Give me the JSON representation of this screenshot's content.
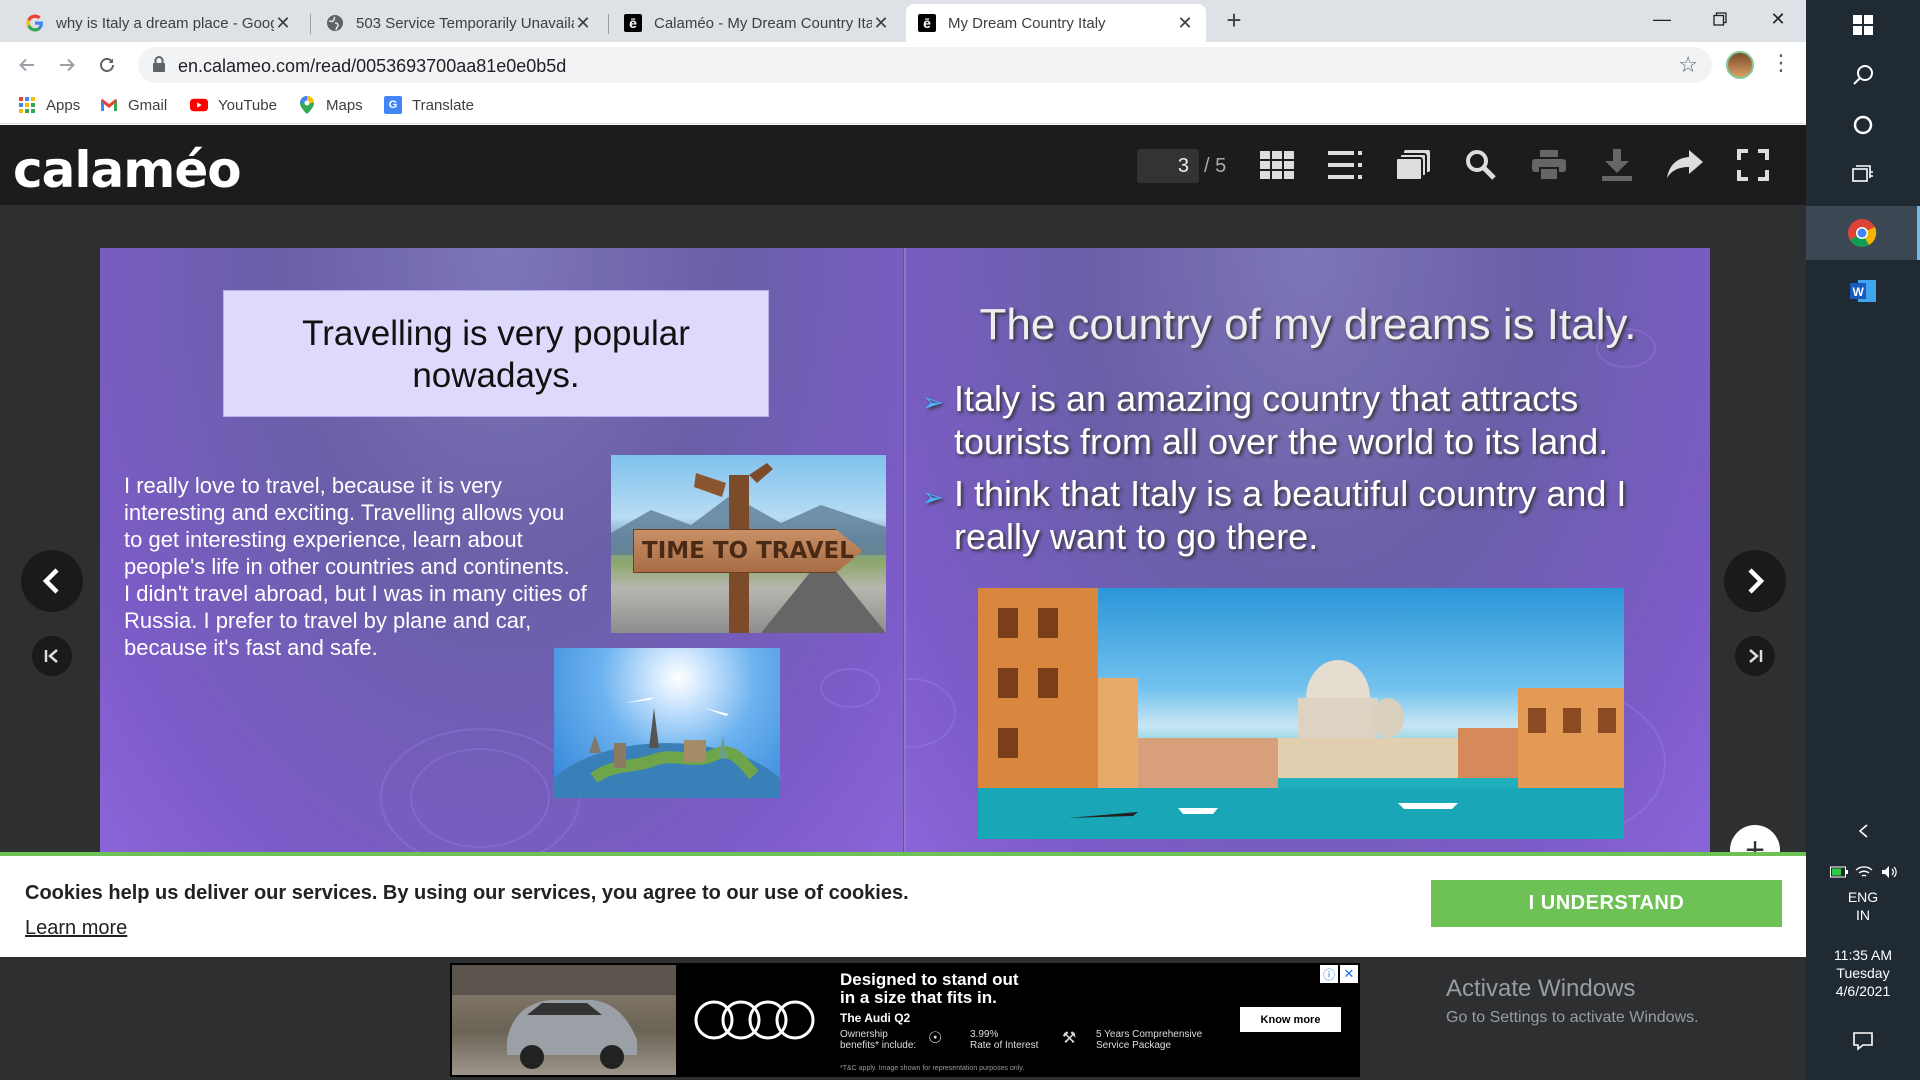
{
  "tabs": [
    {
      "title": "why is Italy a dream place - Goog",
      "icon": "google-icon"
    },
    {
      "title": "503 Service Temporarily Unavaila",
      "icon": "globe-icon"
    },
    {
      "title": "Calaméo - My Dream Country Ita",
      "icon": "calameo-icon"
    },
    {
      "title": "My Dream Country Italy",
      "icon": "calameo-icon",
      "active": true
    }
  ],
  "address": {
    "url": "en.calameo.com/read/0053693700aa81e0e0b5d"
  },
  "bookmarks": [
    {
      "label": "Apps",
      "icon": "apps-grid-icon"
    },
    {
      "label": "Gmail",
      "icon": "gmail-icon"
    },
    {
      "label": "YouTube",
      "icon": "youtube-icon"
    },
    {
      "label": "Maps",
      "icon": "maps-pin-icon"
    },
    {
      "label": "Translate",
      "icon": "translate-icon"
    }
  ],
  "viewer": {
    "logo": "calaméo",
    "page_current": "3",
    "page_total": "/ 5"
  },
  "left_page": {
    "title": "Travelling is very popular nowadays.",
    "title_lines": [
      "Travelling is very popular",
      "nowadays."
    ],
    "body_lines": [
      "I really love to travel, because it is very",
      "interesting and exciting. Travelling allows you",
      "to get interesting experience, learn about",
      "people's life in other countries and continents.",
      "I didn't travel abroad, but I was in many cities of",
      "Russia. I prefer to travel by plane and car,",
      "because it's fast and safe."
    ],
    "sign_text": "TIME TO TRAVEL"
  },
  "right_page": {
    "title": "The country of my dreams is Italy.",
    "bullets": [
      [
        "Italy is an amazing country that attracts",
        "tourists from all over the world to its land."
      ],
      [
        "I think that Italy is a beautiful country and I",
        "really want to go there."
      ]
    ]
  },
  "cookie": {
    "text": "Cookies help us deliver our services. By using our services, you agree to our use of cookies.",
    "learn_more": "Learn more",
    "button": "I UNDERSTAND"
  },
  "ad": {
    "headline_1": "Designed to stand out",
    "headline_2": "in a size that fits in.",
    "model": "The Audi Q2",
    "ownership_1": "Ownership",
    "ownership_2": "benefits* include:",
    "rate_1": "3.99%",
    "rate_2": "Rate of Interest",
    "service_1": "5 Years Comprehensive",
    "service_2": "Service Package",
    "disclaimer": "*T&C apply. Image shown for representation purposes only.",
    "cta": "Know more"
  },
  "activate_windows": {
    "title": "Activate Windows",
    "subtitle": "Go to Settings to activate Windows."
  },
  "taskbar": {
    "lang_1": "ENG",
    "lang_2": "IN",
    "time": "11:35 AM",
    "day": "Tuesday",
    "date": "4/6/2021"
  },
  "colors": {
    "accent_green": "#6ec154",
    "calameo_bar": "#1c1c1c",
    "page_purple": "#6a5fa8"
  }
}
